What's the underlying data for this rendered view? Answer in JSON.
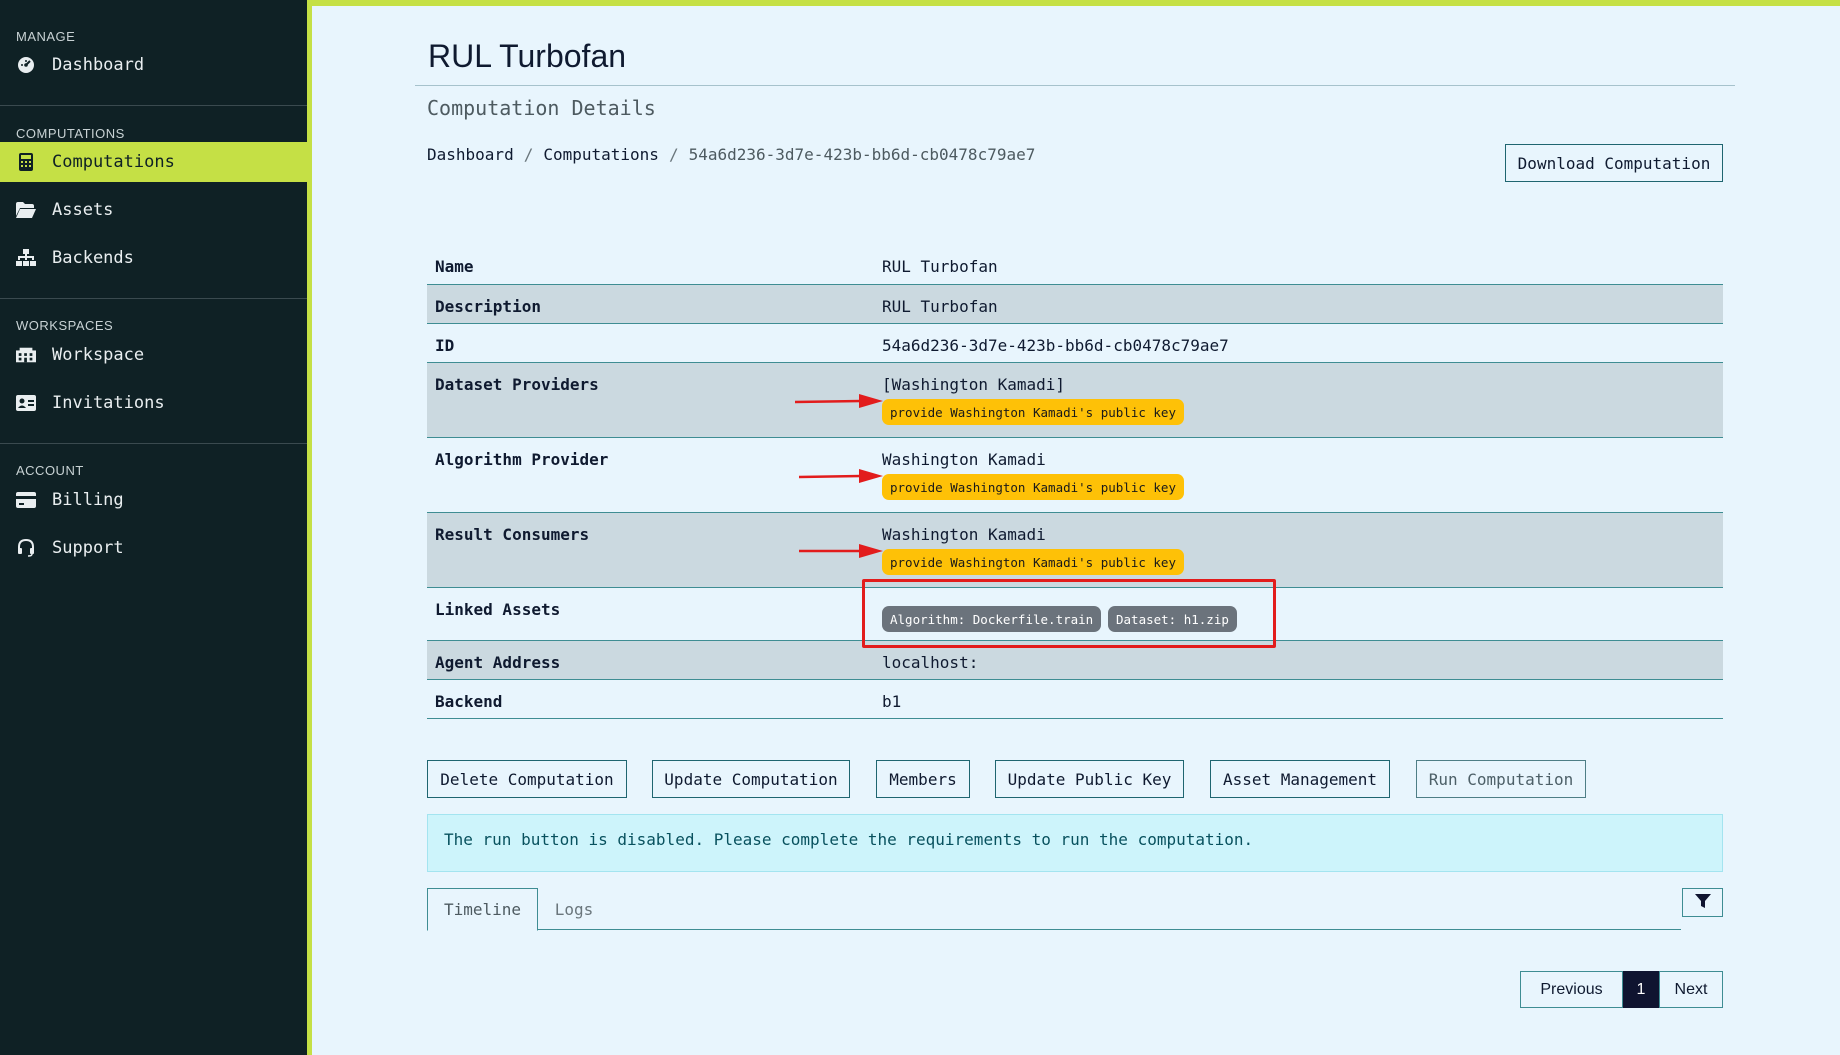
{
  "sidebar": {
    "sections": [
      {
        "title": "MANAGE"
      },
      {
        "title": "COMPUTATIONS"
      },
      {
        "title": "WORKSPACES"
      },
      {
        "title": "ACCOUNT"
      }
    ],
    "items": [
      {
        "label": "Dashboard",
        "icon": "dashboard-gauge-icon"
      },
      {
        "label": "Computations",
        "icon": "calculator-icon",
        "active": true
      },
      {
        "label": "Assets",
        "icon": "folder-open-icon"
      },
      {
        "label": "Backends",
        "icon": "sitemap-icon"
      },
      {
        "label": "Workspace",
        "icon": "building-icon"
      },
      {
        "label": "Invitations",
        "icon": "id-card-icon"
      },
      {
        "label": "Billing",
        "icon": "credit-card-icon"
      },
      {
        "label": "Support",
        "icon": "headset-icon"
      }
    ]
  },
  "header": {
    "title": "RUL Turbofan",
    "subtitle": "Computation Details",
    "download_label": "Download Computation"
  },
  "breadcrumb": {
    "items": [
      "Dashboard",
      "Computations",
      "54a6d236-3d7e-423b-bb6d-cb0478c79ae7"
    ],
    "separator": "/"
  },
  "details": {
    "name": {
      "label": "Name",
      "value": "RUL Turbofan"
    },
    "description": {
      "label": "Description",
      "value": "RUL Turbofan"
    },
    "id": {
      "label": "ID",
      "value": "54a6d236-3d7e-423b-bb6d-cb0478c79ae7"
    },
    "dataset_providers": {
      "label": "Dataset Providers",
      "value": "[Washington Kamadi]",
      "badge": "provide Washington Kamadi's public key"
    },
    "algorithm_provider": {
      "label": "Algorithm Provider",
      "value": "Washington Kamadi",
      "badge": "provide Washington Kamadi's public key"
    },
    "result_consumers": {
      "label": "Result Consumers",
      "value": "Washington Kamadi",
      "badge": "provide Washington Kamadi's public key"
    },
    "linked_assets": {
      "label": "Linked Assets",
      "assets": [
        "Algorithm: Dockerfile.train",
        "Dataset: h1.zip"
      ]
    },
    "agent_address": {
      "label": "Agent Address",
      "value": "localhost:"
    },
    "backend": {
      "label": "Backend",
      "value": "b1"
    }
  },
  "actions": {
    "delete": "Delete Computation",
    "update": "Update Computation",
    "members": "Members",
    "update_key": "Update Public Key",
    "asset_management": "Asset Management",
    "run": "Run Computation"
  },
  "info_message": "The run button is disabled. Please complete the requirements to run the computation.",
  "tabs": [
    {
      "label": "Timeline",
      "active": true
    },
    {
      "label": "Logs",
      "active": false
    }
  ],
  "pagination": {
    "previous": "Previous",
    "current": "1",
    "next": "Next"
  },
  "colors": {
    "sidebar_bg": "#0f2125",
    "accent": "#c5e045",
    "page_bg": "#e8f5fd",
    "badge_warning": "#fec107",
    "badge_asset": "#6b737c",
    "annotation_red": "#e21c1c"
  }
}
